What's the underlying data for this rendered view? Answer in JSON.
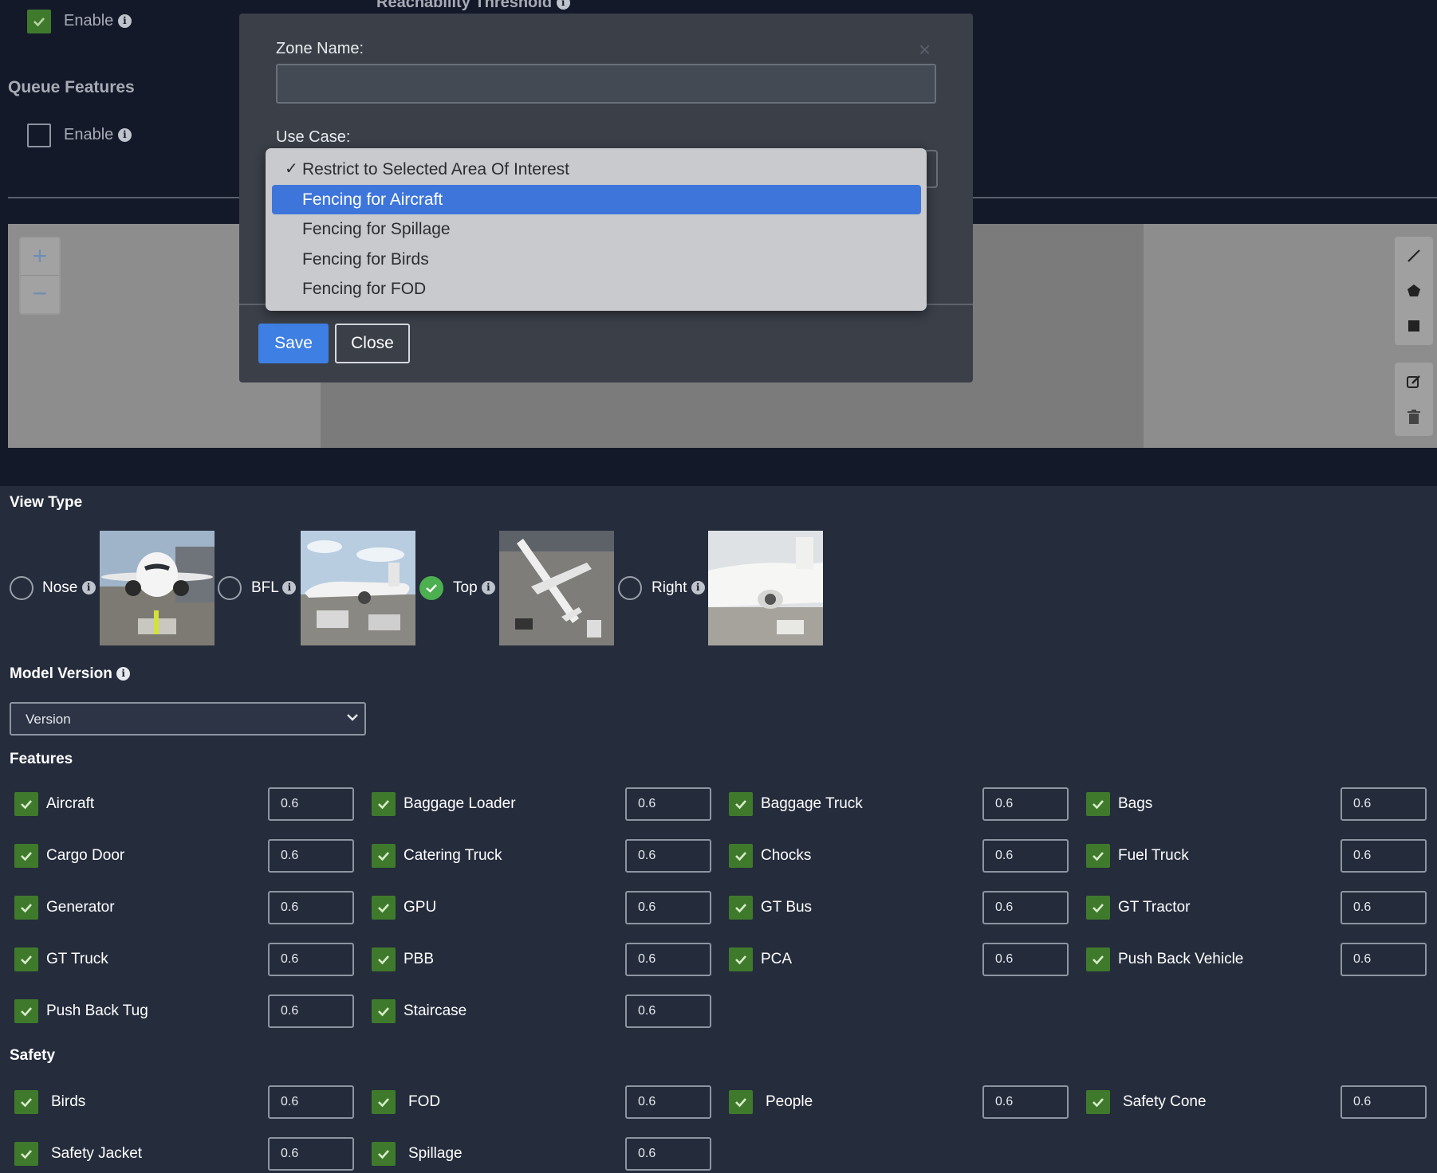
{
  "top": {
    "reach_threshold_label": "Reachability Threshold",
    "enable_label": "Enable",
    "queue_title": "Queue Features",
    "queue_enable_label": "Enable"
  },
  "map": {
    "zoom_in": "+",
    "zoom_out": "−"
  },
  "modal": {
    "zone_name_label": "Zone Name:",
    "zone_name_value": "",
    "use_case_label": "Use Case:",
    "use_case_options": [
      "Restrict to Selected Area Of Interest",
      "Fencing for Aircraft",
      "Fencing for Spillage",
      "Fencing for Birds",
      "Fencing for FOD"
    ],
    "checked_option": "Restrict to Selected Area Of Interest",
    "highlighted_option": "Fencing for Aircraft",
    "close_x": "×",
    "save_label": "Save",
    "close_label": "Close"
  },
  "view_type": {
    "title": "View Type",
    "options": [
      {
        "label": "Nose",
        "selected": false
      },
      {
        "label": "BFL",
        "selected": false
      },
      {
        "label": "Top",
        "selected": true
      },
      {
        "label": "Right",
        "selected": false
      }
    ]
  },
  "model_version": {
    "title": "Model Version",
    "value": "Version"
  },
  "features": {
    "title": "Features",
    "items": [
      {
        "label": "Aircraft",
        "value": "0.6"
      },
      {
        "label": "Baggage Loader",
        "value": "0.6"
      },
      {
        "label": "Baggage Truck",
        "value": "0.6"
      },
      {
        "label": "Bags",
        "value": "0.6"
      },
      {
        "label": "Cargo Door",
        "value": "0.6"
      },
      {
        "label": "Catering Truck",
        "value": "0.6"
      },
      {
        "label": "Chocks",
        "value": "0.6"
      },
      {
        "label": "Fuel Truck",
        "value": "0.6"
      },
      {
        "label": "Generator",
        "value": "0.6"
      },
      {
        "label": "GPU",
        "value": "0.6"
      },
      {
        "label": "GT Bus",
        "value": "0.6"
      },
      {
        "label": "GT Tractor",
        "value": "0.6"
      },
      {
        "label": "GT Truck",
        "value": "0.6"
      },
      {
        "label": "PBB",
        "value": "0.6"
      },
      {
        "label": "PCA",
        "value": "0.6"
      },
      {
        "label": "Push Back Vehicle",
        "value": "0.6"
      },
      {
        "label": "Push Back Tug",
        "value": "0.6"
      },
      {
        "label": "Staircase",
        "value": "0.6"
      }
    ]
  },
  "safety": {
    "title": "Safety",
    "items": [
      {
        "label": "Birds",
        "value": "0.6"
      },
      {
        "label": "FOD",
        "value": "0.6"
      },
      {
        "label": "People",
        "value": "0.6"
      },
      {
        "label": "Safety Cone",
        "value": "0.6"
      },
      {
        "label": "Safety Jacket",
        "value": "0.6"
      },
      {
        "label": "Spillage",
        "value": "0.6"
      }
    ]
  },
  "colors": {
    "accent_blue": "#3e7fe3",
    "check_green": "#3f7a2c",
    "radio_green": "#4caf50",
    "panel_bg": "#252c3c"
  }
}
